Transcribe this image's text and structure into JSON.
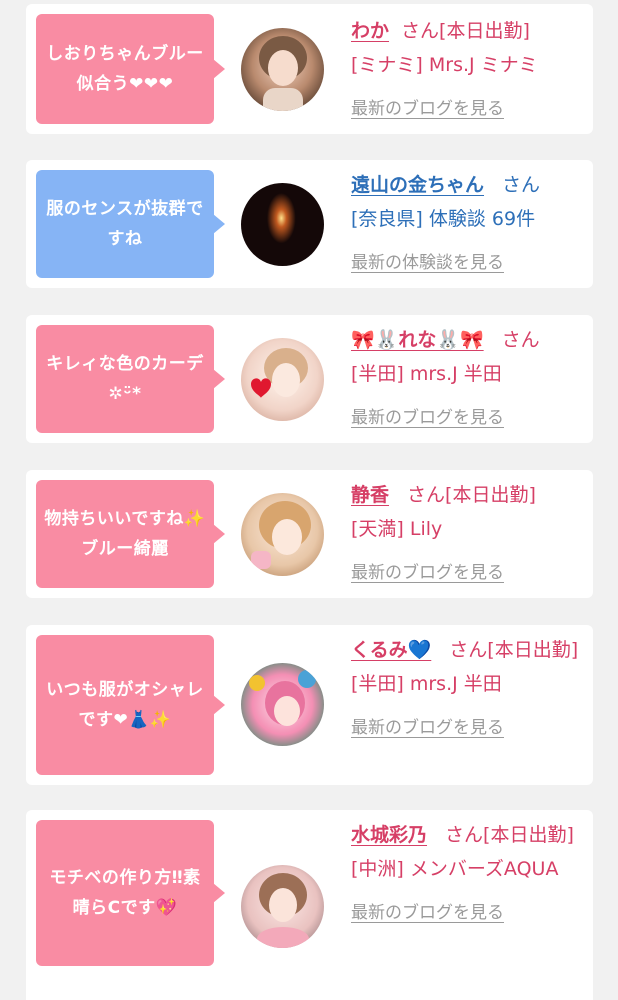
{
  "reviews": [
    {
      "comment": "しおりちゃんブルー似合う❤❤❤",
      "bubble_color": "#f98ca3",
      "avatar": "avatar-photo",
      "name": "わか",
      "honorific": "さん",
      "status": "[本日出勤]",
      "shop": "[ミナミ] Mrs.J ミナミ",
      "link": "最新のブログを見る"
    },
    {
      "comment": "服のセンスが抜群ですね",
      "bubble_color": "#86b4f5",
      "avatar": "avatar-photo",
      "name": "遠山の金ちゃん",
      "honorific": "さん",
      "status": "",
      "shop": "[奈良県] 体験談 69件",
      "link": "最新の体験談を見る"
    },
    {
      "comment": "キレィな色のカーデ✲ᵕ̈*",
      "bubble_color": "#f98ca3",
      "avatar": "avatar-photo",
      "name": "🎀🐰れな🐰🎀",
      "honorific": "さん",
      "status": "",
      "shop": "[半田] mrs.J 半田",
      "link": "最新のブログを見る"
    },
    {
      "comment": "物持ちいいですね✨ブルー綺麗",
      "bubble_color": "#f98ca3",
      "avatar": "avatar-photo",
      "name": "静香",
      "honorific": "さん",
      "status": "[本日出勤]",
      "shop": "[天満] Lily",
      "link": "最新のブログを見る"
    },
    {
      "comment": "いつも服がオシャレです❤👗✨",
      "bubble_color": "#f98ca3",
      "avatar": "avatar-photo",
      "name": "くるみ💙",
      "honorific": "さん",
      "status": "[本日出勤]",
      "shop": "[半田] mrs.J 半田",
      "link": "最新のブログを見る"
    },
    {
      "comment": "モチベの作り方‼素晴らCです💖",
      "bubble_color": "#f98ca3",
      "avatar": "avatar-photo",
      "name": "水城彩乃",
      "honorific": "さん",
      "status": "[本日出勤]",
      "shop": "[中洲] メンバーズAQUA",
      "link": "最新のブログを見る"
    }
  ]
}
